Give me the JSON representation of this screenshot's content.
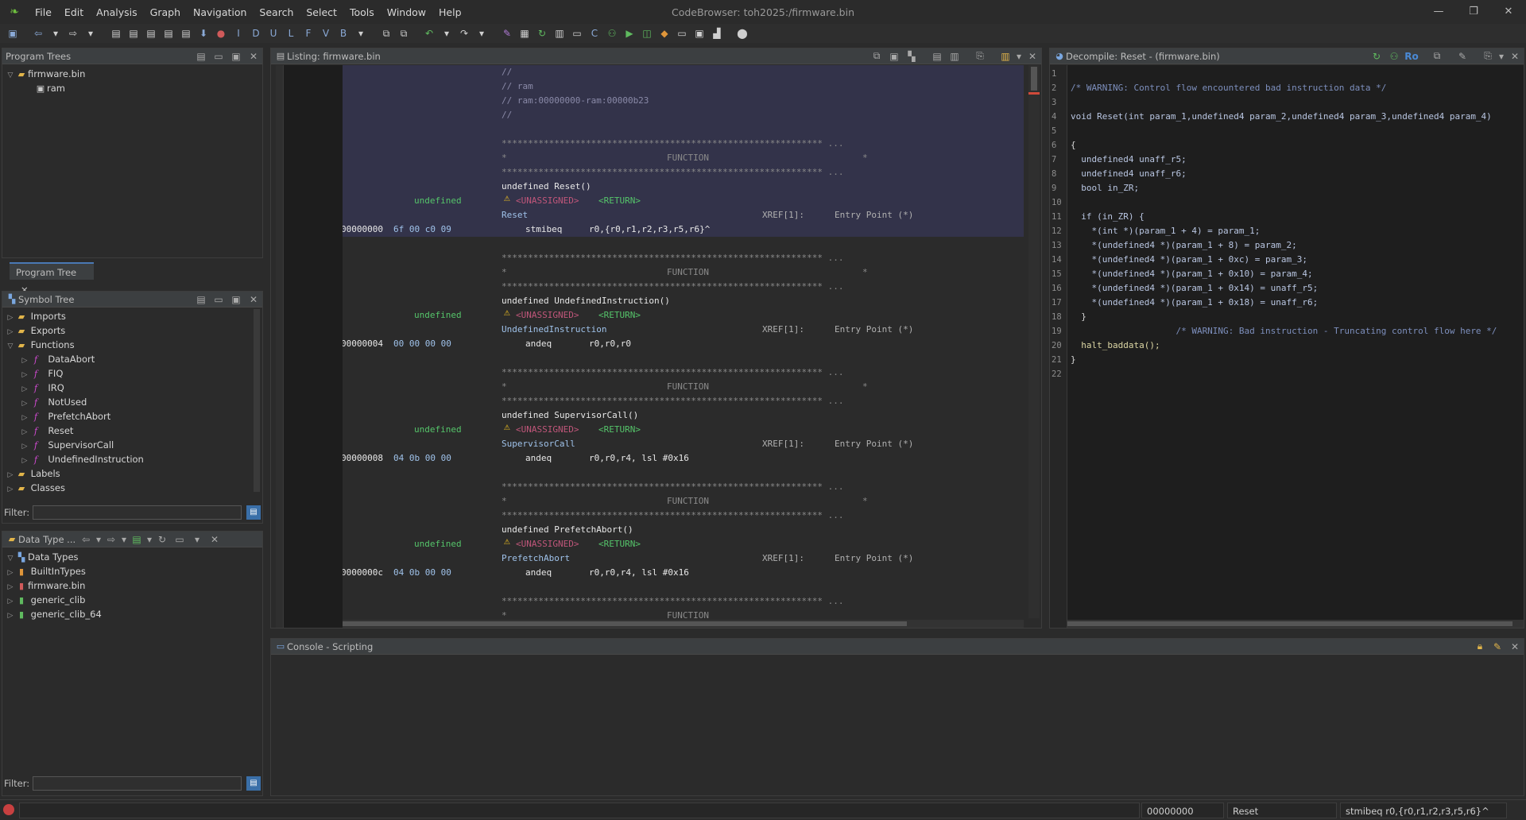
{
  "window": {
    "title": "CodeBrowser: toh2025:/firmware.bin"
  },
  "menu": [
    "File",
    "Edit",
    "Analysis",
    "Graph",
    "Navigation",
    "Search",
    "Select",
    "Tools",
    "Window",
    "Help"
  ],
  "program_trees": {
    "title": "Program Trees",
    "root": "firmware.bin",
    "child": "ram",
    "tab": "Program Tree"
  },
  "symbol_tree": {
    "title": "Symbol Tree",
    "imports": "Imports",
    "exports": "Exports",
    "functions": "Functions",
    "function_items": [
      "DataAbort",
      "FIQ",
      "IRQ",
      "NotUsed",
      "PrefetchAbort",
      "Reset",
      "SupervisorCall",
      "UndefinedInstruction"
    ],
    "labels": "Labels",
    "classes": "Classes",
    "filter_label": "Filter:"
  },
  "data_types": {
    "title": "Data Type ...",
    "root": "Data Types",
    "items": [
      "BuiltInTypes",
      "firmware.bin",
      "generic_clib",
      "generic_clib_64"
    ],
    "filter_label": "Filter:"
  },
  "listing": {
    "title": "Listing:  firmware.bin",
    "header_comments": [
      "//",
      "// ram",
      "// ram:00000000-ram:00000b23",
      "//"
    ],
    "stars": "************************************************************* ...",
    "function_label": "FUNCTION",
    "unassigned": "<UNASSIGNED>",
    "return": "<RETURN>",
    "undefined": "undefined",
    "xref": "XREF[1]:",
    "entry_point": "Entry Point (*)",
    "functions": [
      {
        "sig": "undefined Reset()",
        "label": "Reset",
        "addr": "00000000",
        "bytes": "6f 00 c0 09",
        "mnemonic": "stmibeq",
        "operands": "r0,{r0,r1,r2,r3,r5,r6}^"
      },
      {
        "sig": "undefined UndefinedInstruction()",
        "label": "UndefinedInstruction",
        "addr": "00000004",
        "bytes": "00 00 00 00",
        "mnemonic": "andeq",
        "operands": "r0,r0,r0"
      },
      {
        "sig": "undefined SupervisorCall()",
        "label": "SupervisorCall",
        "addr": "00000008",
        "bytes": "04 0b 00 00",
        "mnemonic": "andeq",
        "operands": "r0,r0,r4, lsl #0x16"
      },
      {
        "sig": "undefined PrefetchAbort()",
        "label": "PrefetchAbort",
        "addr": "0000000c",
        "bytes": "04 0b 00 00",
        "mnemonic": "andeq",
        "operands": "r0,r0,r4, lsl #0x16"
      }
    ]
  },
  "decompile": {
    "title": "Decompile: Reset -  (firmware.bin)",
    "ro": "Ro",
    "line_numbers": [
      "1",
      "2",
      "3",
      "4",
      "5",
      "6",
      "7",
      "8",
      "9",
      "10",
      "11",
      "12",
      "13",
      "14",
      "15",
      "16",
      "17",
      "18",
      "19",
      "20",
      "21",
      "22"
    ],
    "lines": [
      "",
      "/* WARNING: Control flow encountered bad instruction data */",
      "",
      "void Reset(int param_1,undefined4 param_2,undefined4 param_3,undefined4 param_4)",
      "",
      "{",
      "  undefined4 unaff_r5;",
      "  undefined4 unaff_r6;",
      "  bool in_ZR;",
      "",
      "  if (in_ZR) {",
      "    *(int *)(param_1 + 4) = param_1;",
      "    *(undefined4 *)(param_1 + 8) = param_2;",
      "    *(undefined4 *)(param_1 + 0xc) = param_3;",
      "    *(undefined4 *)(param_1 + 0x10) = param_4;",
      "    *(undefined4 *)(param_1 + 0x14) = unaff_r5;",
      "    *(undefined4 *)(param_1 + 0x18) = unaff_r6;",
      "  }",
      "                    /* WARNING: Bad instruction - Truncating control flow here */",
      "  halt_baddata();",
      "}",
      ""
    ]
  },
  "console": {
    "title": "Console - Scripting"
  },
  "status": {
    "address": "00000000",
    "function": "Reset",
    "instruction": "stmibeq r0,{r0,r1,r2,r3,r5,r6}^"
  }
}
